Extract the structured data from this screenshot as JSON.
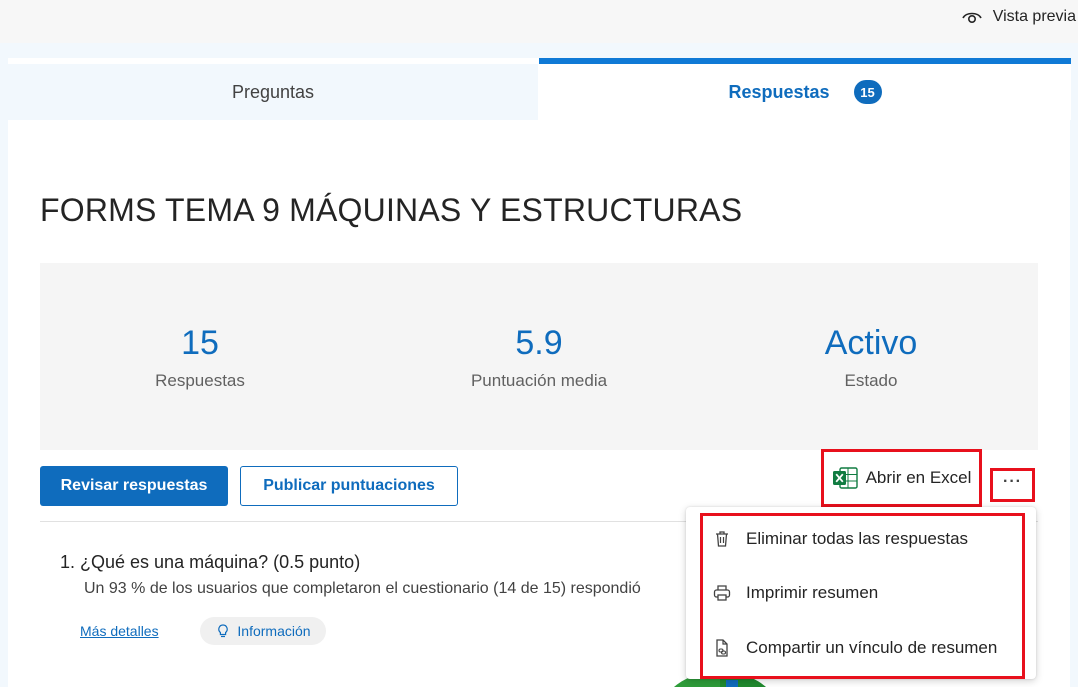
{
  "header": {
    "preview_label": "Vista previa"
  },
  "tabs": {
    "questions_label": "Preguntas",
    "responses_label": "Respuestas",
    "responses_count": "15"
  },
  "form": {
    "title": "FORMS TEMA 9 MÁQUINAS Y ESTRUCTURAS"
  },
  "stats": [
    {
      "value": "15",
      "label": "Respuestas"
    },
    {
      "value": "5.9",
      "label": "Puntuación media"
    },
    {
      "value": "Activo",
      "label": "Estado"
    }
  ],
  "actions": {
    "review_label": "Revisar respuestas",
    "publish_label": "Publicar puntuaciones",
    "excel_label": "Abrir en Excel",
    "more_label": "···"
  },
  "menu": {
    "items": [
      {
        "label": "Eliminar todas las respuestas",
        "icon": "trash-icon"
      },
      {
        "label": "Imprimir resumen",
        "icon": "printer-icon"
      },
      {
        "label": "Compartir un vínculo de resumen",
        "icon": "share-link-icon"
      }
    ]
  },
  "question": {
    "title": "1.  ¿Qué es una máquina? (0.5 punto)",
    "summary": "Un 93 % de los usuarios que completaron el cuestionario (14 de 15) respondió",
    "more_details": "Más detalles",
    "info_label": "Información"
  },
  "colors": {
    "accent": "#0f6cbd",
    "highlight": "#e8101c",
    "excel_green": "#107c41"
  }
}
